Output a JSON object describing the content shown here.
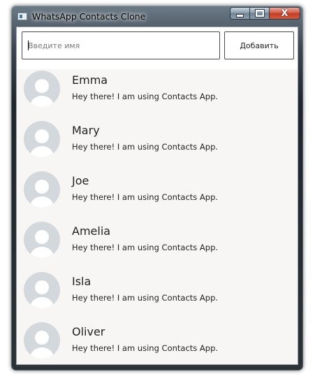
{
  "window": {
    "title": "WhatsApp Contacts Clone",
    "icon": "app-window-icon",
    "caption": {
      "minimize": "minimize-icon",
      "maximize": "maximize-icon",
      "close_glyph": "X"
    }
  },
  "toolbar": {
    "name_input": {
      "placeholder": "Введите имя",
      "value": ""
    },
    "add_label": "Добавить"
  },
  "contacts": [
    {
      "name": "Emma",
      "status": "Hey there! I am using Contacts App.",
      "avatar": "user-avatar-icon"
    },
    {
      "name": "Mary",
      "status": "Hey there! I am using Contacts App.",
      "avatar": "user-avatar-icon"
    },
    {
      "name": "Joe",
      "status": "Hey there! I am using Contacts App.",
      "avatar": "user-avatar-icon"
    },
    {
      "name": "Amelia",
      "status": "Hey there! I am using Contacts App.",
      "avatar": "user-avatar-icon"
    },
    {
      "name": "Isla",
      "status": "Hey there! I am using Contacts App.",
      "avatar": "user-avatar-icon"
    },
    {
      "name": "Oliver",
      "status": "Hey there! I am using Contacts App.",
      "avatar": "user-avatar-icon"
    }
  ],
  "colors": {
    "avatar_bg": "#d3d8dc",
    "list_bg": "#f7f6f4",
    "close_button": "#c23d26"
  }
}
